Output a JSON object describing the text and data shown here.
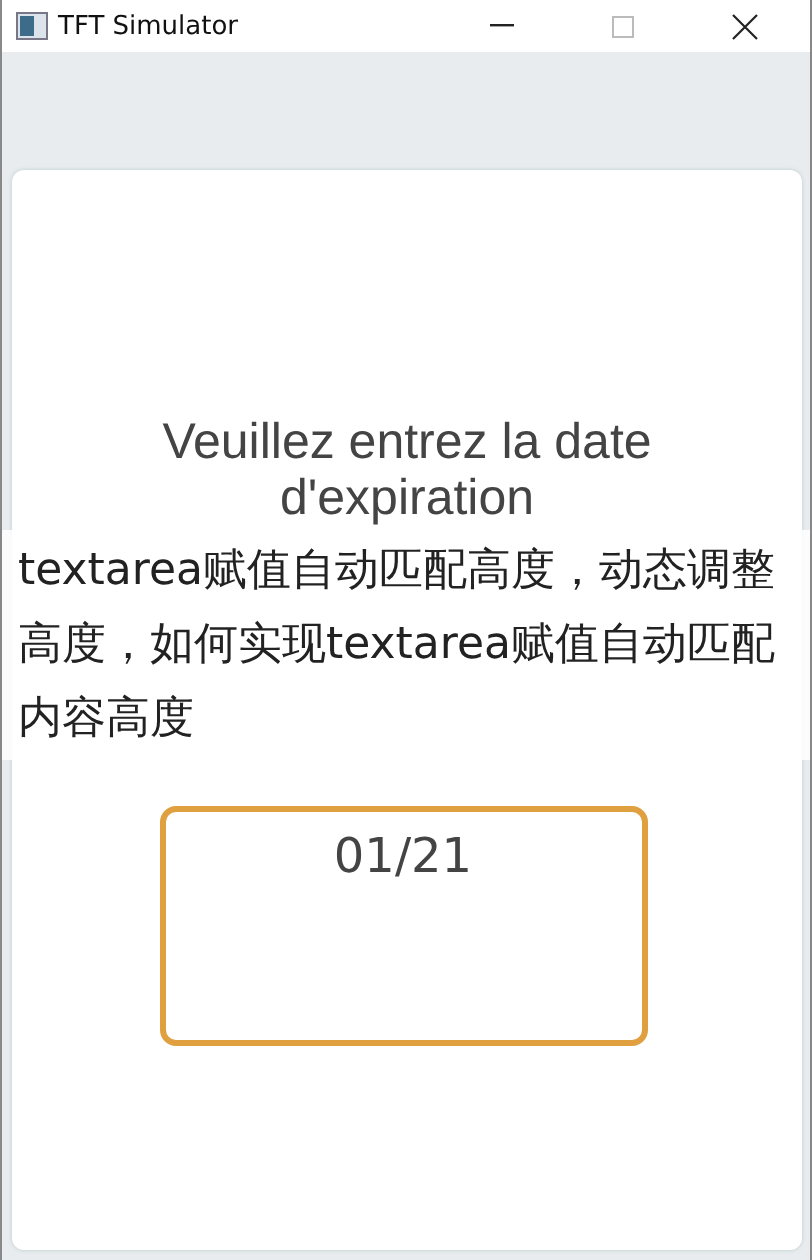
{
  "window": {
    "title": "TFT Simulator"
  },
  "screen": {
    "heading": "Veuillez entrez la date d'expiration",
    "date_field": {
      "value": "01/21"
    }
  },
  "caption": "textarea赋值自动匹配高度，动态调整高度，如何实现textarea赋值自动匹配内容高度"
}
